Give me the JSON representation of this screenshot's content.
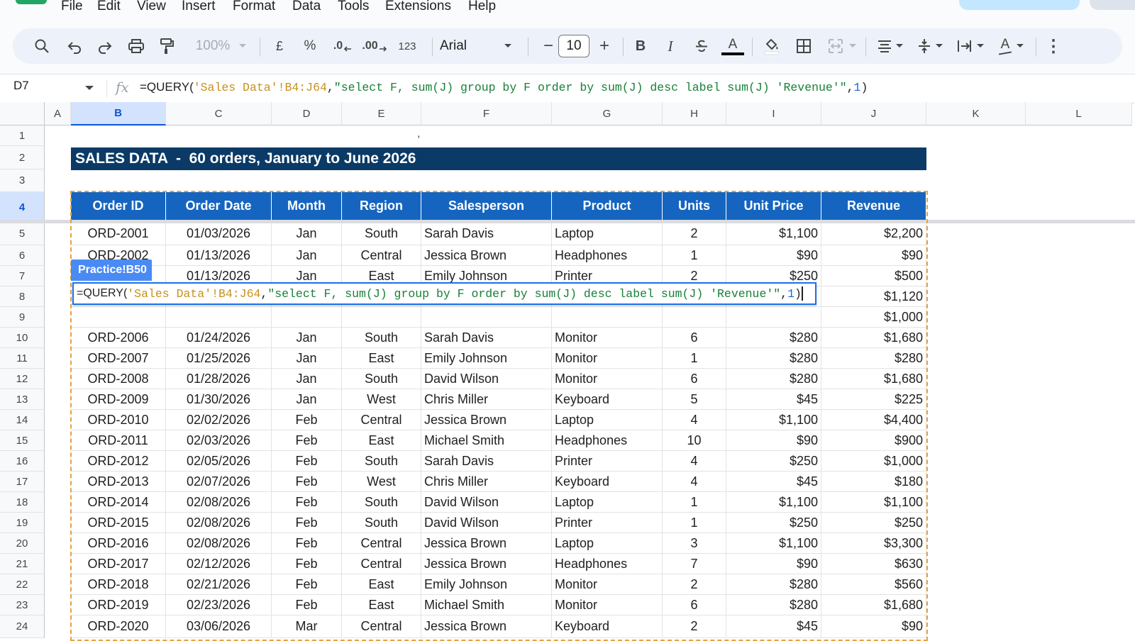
{
  "menu": [
    "File",
    "Edit",
    "View",
    "Insert",
    "Format",
    "Data",
    "Tools",
    "Extensions",
    "Help"
  ],
  "toolbar": {
    "zoom": "100%",
    "currency": "£",
    "percent": "%",
    "decrease_decimal": ".0",
    "increase_decimal": ".00",
    "number_format": "123",
    "font": "Arial",
    "font_size": "10",
    "minus": "−",
    "plus": "+",
    "bold": "B",
    "italic": "I",
    "underline_a": "A",
    "text_rotation_a": "A",
    "more": "⋮"
  },
  "formula_bar": {
    "cell_ref": "D7",
    "fx": "fx",
    "formula": {
      "fn": "=QUERY(",
      "range": "'Sales Data'!B4:J64",
      "comma1": ",",
      "query": "\"select F, sum(J) group by F order by sum(J) desc label sum(J) 'Revenue'\"",
      "comma2": ",",
      "headers": "1",
      "close": ")"
    }
  },
  "columns": [
    "A",
    "B",
    "C",
    "D",
    "E",
    "F",
    "G",
    "H",
    "I",
    "J",
    "K",
    "L"
  ],
  "selected_column": "B",
  "row_numbers": [
    "1",
    "2",
    "3",
    "4",
    "5",
    "6",
    "7",
    "8",
    "9",
    "10",
    "11",
    "12",
    "13",
    "14",
    "15",
    "16",
    "17",
    "18",
    "19",
    "20",
    "21",
    "22",
    "23",
    "24"
  ],
  "selected_row": "4",
  "stray_mark": ",",
  "title": "SALES DATA  -  60 orders, January to June 2026",
  "table": {
    "headers": [
      "Order ID",
      "Order Date",
      "Month",
      "Region",
      "Salesperson",
      "Product",
      "Units",
      "Unit Price",
      "Revenue"
    ],
    "rows": [
      [
        "ORD-2001",
        "01/03/2026",
        "Jan",
        "South",
        "Sarah Davis",
        "Laptop",
        "2",
        "$1,100",
        "$2,200"
      ],
      [
        "ORD-2002",
        "01/13/2026",
        "Jan",
        "Central",
        "Jessica Brown",
        "Headphones",
        "1",
        "$90",
        "$90"
      ],
      [
        "",
        "01/13/2026",
        "Jan",
        "East",
        "Emily Johnson",
        "Printer",
        "2",
        "$250",
        "$500"
      ],
      [
        "",
        "",
        "",
        "",
        "",
        "",
        "",
        "",
        "$1,120"
      ],
      [
        "",
        "",
        "",
        "",
        "",
        "",
        "",
        "",
        "$1,000"
      ],
      [
        "ORD-2006",
        "01/24/2026",
        "Jan",
        "South",
        "Sarah Davis",
        "Monitor",
        "6",
        "$280",
        "$1,680"
      ],
      [
        "ORD-2007",
        "01/25/2026",
        "Jan",
        "East",
        "Emily Johnson",
        "Monitor",
        "1",
        "$280",
        "$280"
      ],
      [
        "ORD-2008",
        "01/28/2026",
        "Jan",
        "South",
        "David Wilson",
        "Monitor",
        "6",
        "$280",
        "$1,680"
      ],
      [
        "ORD-2009",
        "01/30/2026",
        "Jan",
        "West",
        "Chris Miller",
        "Keyboard",
        "5",
        "$45",
        "$225"
      ],
      [
        "ORD-2010",
        "02/02/2026",
        "Feb",
        "Central",
        "Jessica Brown",
        "Laptop",
        "4",
        "$1,100",
        "$4,400"
      ],
      [
        "ORD-2011",
        "02/03/2026",
        "Feb",
        "East",
        "Michael Smith",
        "Headphones",
        "10",
        "$90",
        "$900"
      ],
      [
        "ORD-2012",
        "02/05/2026",
        "Feb",
        "South",
        "Sarah Davis",
        "Printer",
        "4",
        "$250",
        "$1,000"
      ],
      [
        "ORD-2013",
        "02/07/2026",
        "Feb",
        "West",
        "Chris Miller",
        "Keyboard",
        "4",
        "$45",
        "$180"
      ],
      [
        "ORD-2014",
        "02/08/2026",
        "Feb",
        "South",
        "David Wilson",
        "Laptop",
        "1",
        "$1,100",
        "$1,100"
      ],
      [
        "ORD-2015",
        "02/08/2026",
        "Feb",
        "South",
        "David Wilson",
        "Printer",
        "1",
        "$250",
        "$250"
      ],
      [
        "ORD-2016",
        "02/08/2026",
        "Feb",
        "Central",
        "Jessica Brown",
        "Laptop",
        "3",
        "$1,100",
        "$3,300"
      ],
      [
        "ORD-2017",
        "02/12/2026",
        "Feb",
        "Central",
        "Jessica Brown",
        "Headphones",
        "7",
        "$90",
        "$630"
      ],
      [
        "ORD-2018",
        "02/21/2026",
        "Feb",
        "East",
        "Emily Johnson",
        "Monitor",
        "2",
        "$280",
        "$560"
      ],
      [
        "ORD-2019",
        "02/23/2026",
        "Feb",
        "East",
        "Michael Smith",
        "Monitor",
        "6",
        "$280",
        "$1,680"
      ],
      [
        "ORD-2020",
        "03/06/2026",
        "Mar",
        "Central",
        "Jessica Brown",
        "Keyboard",
        "2",
        "$45",
        "$90"
      ]
    ]
  },
  "range_chip": "Practice!B50",
  "edit_formula": {
    "fn": "=QUERY(",
    "range": "'Sales Data'!B4:J64",
    "comma1": ",",
    "query": "\"select F, sum(J) group by F order by sum(J) desc label sum(J) 'Revenue'\"",
    "comma2": ",",
    "headers": "1",
    "close": ")"
  },
  "colors": {
    "title_bg": "#0b3a66",
    "header_bg": "#1565c0",
    "dashed_border": "#e8a13a",
    "range_chip": "#4a8af4",
    "selection": "#1a73e8"
  }
}
